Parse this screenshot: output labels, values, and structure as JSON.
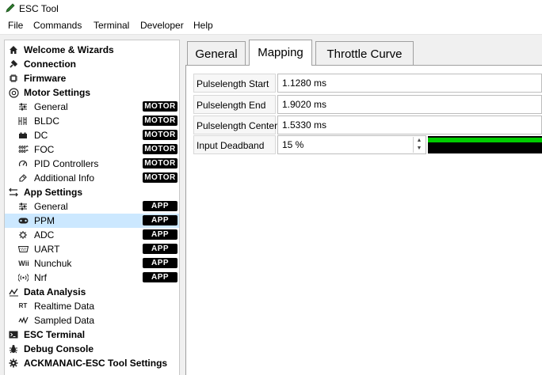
{
  "window": {
    "title": "ESC Tool",
    "icon": "pen-icon"
  },
  "menu": [
    "File",
    "Commands",
    "Terminal",
    "Developer",
    "Help"
  ],
  "sidebar": {
    "welcome": "Welcome & Wizards",
    "connection": "Connection",
    "firmware": "Firmware",
    "motor_settings": "Motor Settings",
    "motor_items": [
      {
        "label": "General",
        "badge": "MOTOR",
        "icon": "sliders-icon"
      },
      {
        "label": "BLDC",
        "badge": "MOTOR",
        "icon": "bldc-icon"
      },
      {
        "label": "DC",
        "badge": "MOTOR",
        "icon": "battery-icon"
      },
      {
        "label": "FOC",
        "badge": "MOTOR",
        "icon": "coil-icon"
      },
      {
        "label": "PID Controllers",
        "badge": "MOTOR",
        "icon": "gauge-icon"
      },
      {
        "label": "Additional Info",
        "badge": "MOTOR",
        "icon": "info-icon"
      }
    ],
    "app_settings": "App Settings",
    "app_items": [
      {
        "label": "General",
        "badge": "APP",
        "icon": "sliders-icon"
      },
      {
        "label": "PPM",
        "badge": "APP",
        "icon": "gamepad-icon"
      },
      {
        "label": "ADC",
        "badge": "APP",
        "icon": "chip-icon"
      },
      {
        "label": "UART",
        "badge": "APP",
        "icon": "serial-port-icon"
      },
      {
        "label": "Nunchuk",
        "badge": "APP",
        "icon": "wii-icon"
      },
      {
        "label": "Nrf",
        "badge": "APP",
        "icon": "wireless-icon"
      }
    ],
    "data_analysis": "Data Analysis",
    "analysis_items": [
      {
        "label": "Realtime Data",
        "icon": "realtime-icon"
      },
      {
        "label": "Sampled Data",
        "icon": "wave-icon"
      }
    ],
    "esc_terminal": "ESC Terminal",
    "debug_console": "Debug Console",
    "tool_settings": "ACKMANAIC-ESC Tool Settings",
    "selected": "PPM"
  },
  "tabs": [
    {
      "label": "General",
      "active": false
    },
    {
      "label": "Mapping",
      "active": true
    },
    {
      "label": "Throttle Curve",
      "active": false
    }
  ],
  "fields": [
    {
      "label": "Pulselength Start",
      "value": "1.1280 ms"
    },
    {
      "label": "Pulselength End",
      "value": "1.9020 ms"
    },
    {
      "label": "Pulselength Center",
      "value": "1.5330 ms"
    },
    {
      "label": "Input Deadband",
      "value": "15 %",
      "level_fraction": 1.0,
      "bar_color": "#00cc00"
    }
  ]
}
